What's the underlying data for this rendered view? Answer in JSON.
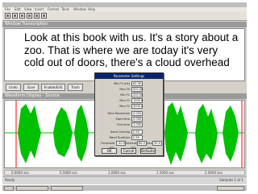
{
  "window": {
    "title_bar": "",
    "menu": [
      "File",
      "Edit",
      "View",
      "Insert",
      "Format",
      "Tools",
      "Window",
      "Help"
    ]
  },
  "text_pane": {
    "title": "Window Transcription",
    "lines": [
      "Look at this book with us. It's a story about a",
      "zoo. That is where we are today it's very",
      "cold out of doors, there's a cloud overhead"
    ]
  },
  "button_row": [
    "Undo",
    "Save",
    "Enable/Edit",
    "Trash"
  ],
  "wave_pane": {
    "title": "Waveform Display - Source"
  },
  "ruler": [
    "0.0000 sec",
    "0.5000 sec",
    "1.0000 sec",
    "1.5000 sec",
    "2.0000 sec"
  ],
  "status": {
    "left": "Ready",
    "right": "Samples 1 of 1"
  },
  "dialog": {
    "title": "Parameter Settings",
    "fields": [
      {
        "label": "Min F0 (Hz)",
        "value": "60.00"
      },
      {
        "label": "Max F0",
        "value": "500.00"
      },
      {
        "label": "Min F1",
        "value": "200.00"
      },
      {
        "label": "Max F1",
        "value": "1000.0"
      },
      {
        "label": "Max F2",
        "value": "3000.0"
      },
      {
        "label": "Time Resolution",
        "value": "0.005"
      },
      {
        "label": "Start time",
        "value": "0.000"
      },
      {
        "label": "End time",
        "value": "3.000"
      },
      {
        "label": "Band Overlap",
        "value": "0.50"
      },
      {
        "label": "Band Duration",
        "value": "0.50"
      },
      {
        "label": "Threshold (dB)",
        "value": "-40.0"
      },
      {
        "label": "Intensity (dB)",
        "value": "60.0"
      },
      {
        "label": "Intensity bw",
        "value": "30.0"
      }
    ],
    "buttons": [
      "OK",
      "Cancel",
      "Defaults"
    ]
  },
  "colors": {
    "waveform": "#00c000",
    "cursor": "#ff0000",
    "dialog_title_bg": "#0a246a",
    "pane_title_bg": "#9a9a9a"
  }
}
